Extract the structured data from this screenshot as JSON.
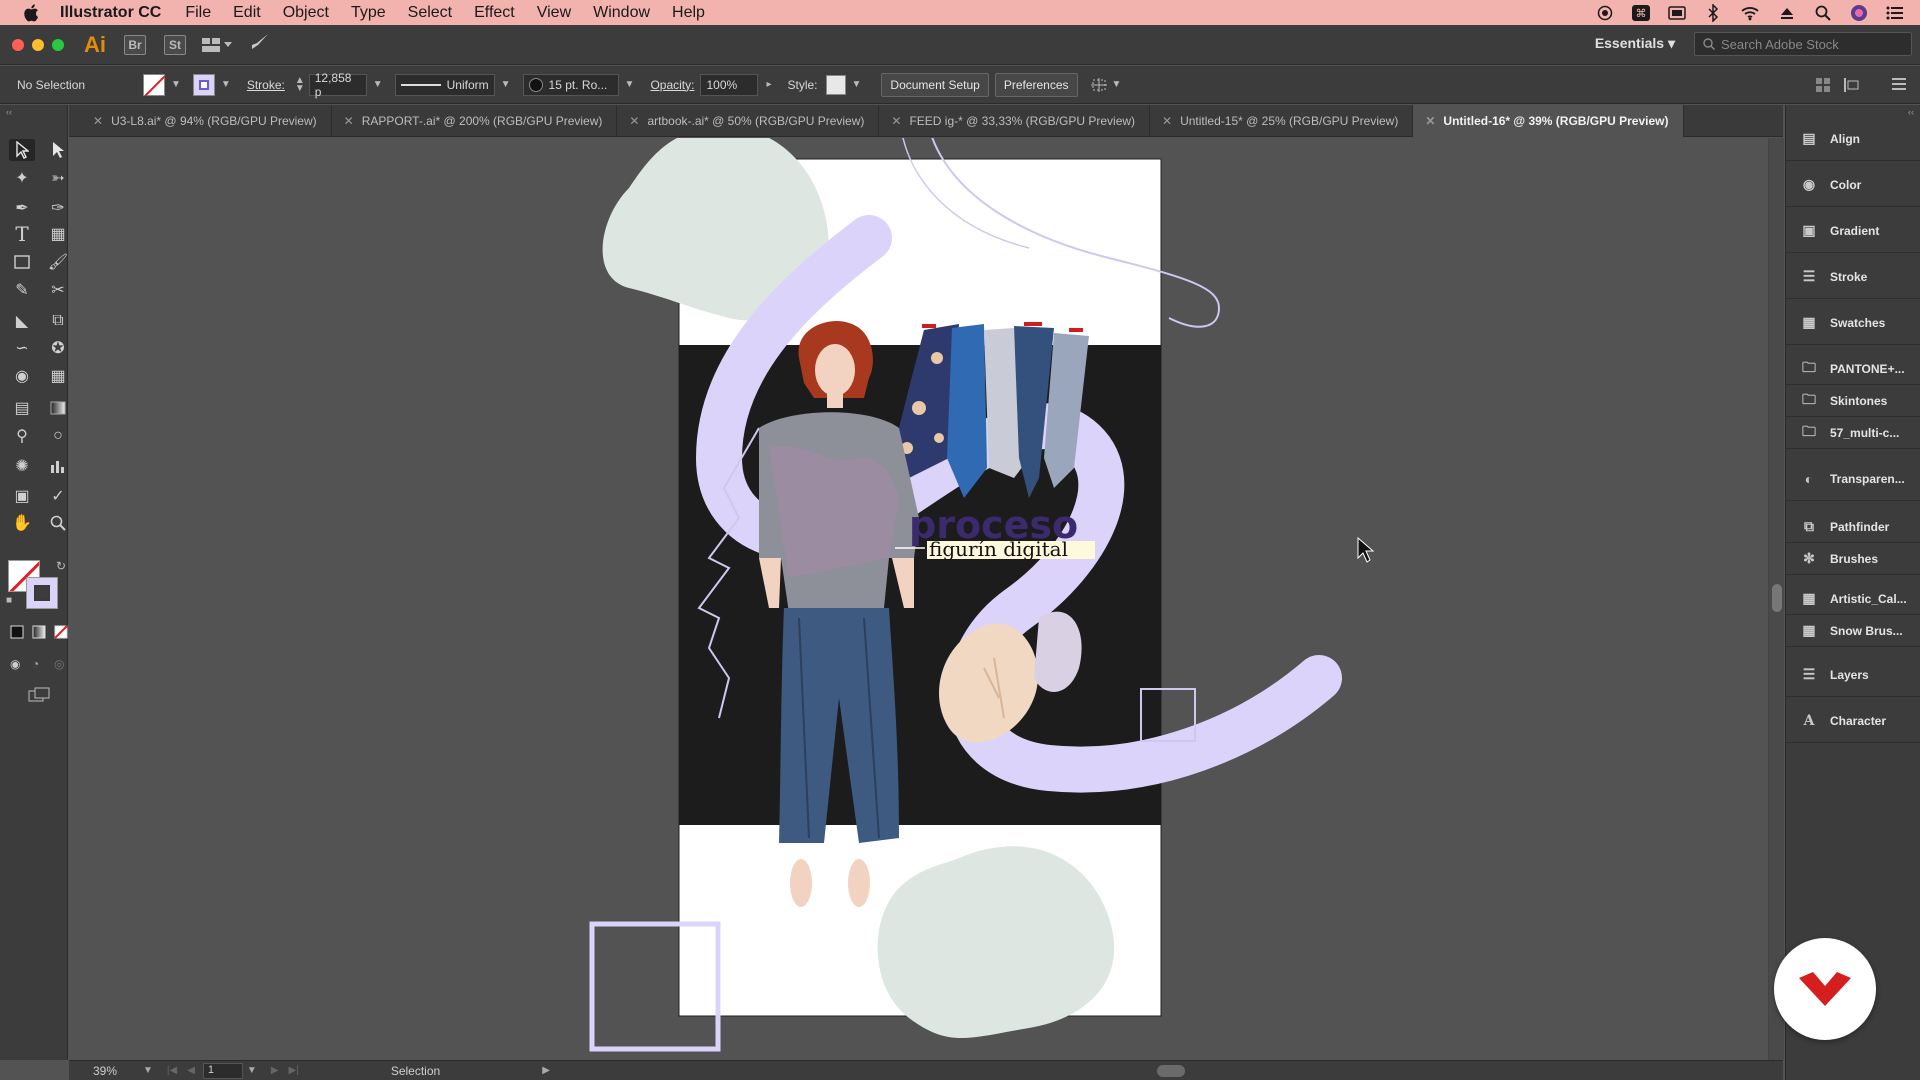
{
  "menubar": {
    "app_name": "Illustrator CC",
    "items": [
      "File",
      "Edit",
      "Object",
      "Type",
      "Select",
      "Effect",
      "View",
      "Window",
      "Help"
    ]
  },
  "appbar": {
    "logo": "Ai",
    "bridge": "Br",
    "stock": "St",
    "workspace": "Essentials",
    "search_placeholder": "Search Adobe Stock"
  },
  "controlbar": {
    "selection": "No Selection",
    "stroke_label": "Stroke:",
    "stroke_value": "12,858 p",
    "profile": "Uniform",
    "brush": "15 pt. Ro...",
    "opacity_label": "Opacity:",
    "opacity_value": "100%",
    "style_label": "Style:",
    "doc_setup": "Document Setup",
    "preferences": "Preferences"
  },
  "tabs": [
    {
      "label": "U3-L8.ai* @ 94% (RGB/GPU Preview)",
      "active": false
    },
    {
      "label": "RAPPORT-.ai* @ 200% (RGB/GPU Preview)",
      "active": false
    },
    {
      "label": "artbook-.ai* @ 50% (RGB/GPU Preview)",
      "active": false
    },
    {
      "label": "FEED ig-* @ 33,33% (RGB/GPU Preview)",
      "active": false
    },
    {
      "label": "Untitled-15* @ 25% (RGB/GPU Preview)",
      "active": false
    },
    {
      "label": "Untitled-16* @ 39% (RGB/GPU Preview)",
      "active": true
    }
  ],
  "artwork": {
    "title": "proceso",
    "subtitle": "figurín digital"
  },
  "statusbar": {
    "zoom": "39%",
    "page": "1",
    "mode": "Selection"
  },
  "panels": [
    {
      "label": "Align",
      "icon": "align-icon"
    },
    {
      "label": "Color",
      "icon": "color-icon"
    },
    {
      "label": "Gradient",
      "icon": "gradient-icon"
    },
    {
      "label": "Stroke",
      "icon": "stroke-icon"
    },
    {
      "label": "Swatches",
      "icon": "swatches-icon"
    },
    {
      "label": "PANTONE+...",
      "icon": "folder-icon"
    },
    {
      "label": "Skintones",
      "icon": "folder-icon"
    },
    {
      "label": "57_multi-c...",
      "icon": "folder-icon"
    },
    {
      "label": "Transparen...",
      "icon": "transparency-icon"
    },
    {
      "label": "Pathfinder",
      "icon": "pathfinder-icon"
    },
    {
      "label": "Brushes",
      "icon": "brushes-icon"
    },
    {
      "label": "Artistic_Cal...",
      "icon": "brush-library-icon"
    },
    {
      "label": "Snow Brus...",
      "icon": "brush-library-icon"
    },
    {
      "label": "Layers",
      "icon": "layers-icon"
    },
    {
      "label": "Character",
      "icon": "character-icon"
    }
  ],
  "colors": {
    "menubar": "#f2b3ae",
    "chrome": "#3c3c3c",
    "canvas": "#535353",
    "lavender": "#dcd3fb",
    "sage": "#dde6e1",
    "ink": "#3b2a6e"
  }
}
